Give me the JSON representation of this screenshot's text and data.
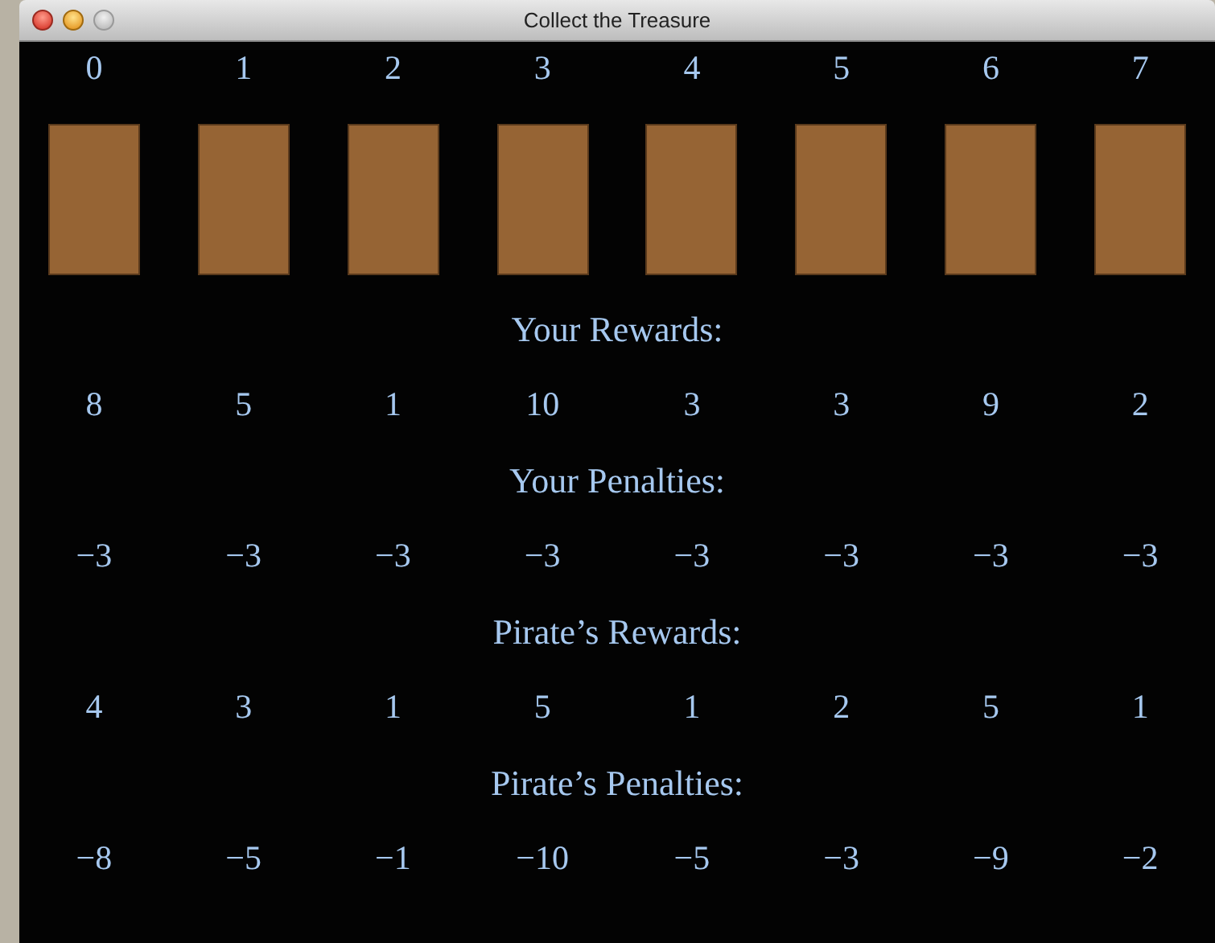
{
  "window": {
    "title": "Collect the Treasure"
  },
  "columns": [
    "0",
    "1",
    "2",
    "3",
    "4",
    "5",
    "6",
    "7"
  ],
  "sections": [
    {
      "heading": "Your Rewards:",
      "values": [
        "8",
        "5",
        "1",
        "10",
        "3",
        "3",
        "9",
        "2"
      ]
    },
    {
      "heading": "Your Penalties:",
      "values": [
        "−3",
        "−3",
        "−3",
        "−3",
        "−3",
        "−3",
        "−3",
        "−3"
      ]
    },
    {
      "heading": "Pirate’s Rewards:",
      "values": [
        "4",
        "3",
        "1",
        "5",
        "1",
        "2",
        "5",
        "1"
      ]
    },
    {
      "heading": "Pirate’s Penalties:",
      "values": [
        "−8",
        "−5",
        "−1",
        "−10",
        "−5",
        "−3",
        "−9",
        "−2"
      ]
    }
  ]
}
